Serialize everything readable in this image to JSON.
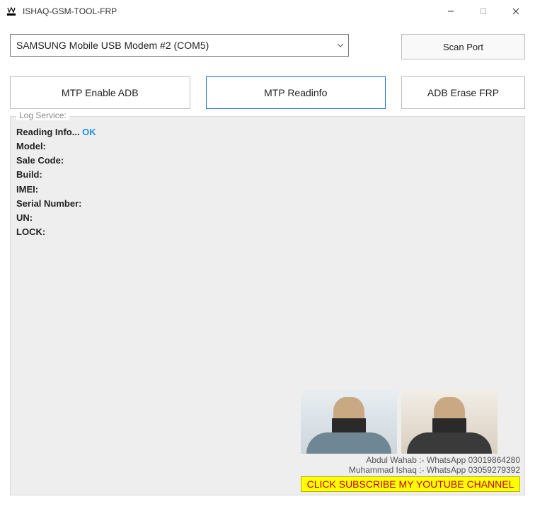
{
  "window": {
    "title": "ISHAQ-GSM-TOOL-FRP"
  },
  "port": {
    "selected": "SAMSUNG Mobile USB Modem #2 (COM5)"
  },
  "buttons": {
    "scan": "Scan Port",
    "mtp_adb": "MTP Enable ADB",
    "mtp_read": "MTP Readinfo",
    "adb_frp": "ADB Erase FRP"
  },
  "log": {
    "legend": "Log Service:",
    "reading_prefix": "Reading Info... ",
    "reading_status": "OK",
    "fields": {
      "model": "Model:",
      "sale": "Sale Code:",
      "build": "Build:",
      "imei": "IMEI:",
      "serial": "Serial Number:",
      "un": "UN:",
      "lock": "LOCK:"
    }
  },
  "footer": {
    "contact1": "Abdul Wahab :- WhatsApp 03019864280",
    "contact2": "Muhammad Ishaq :- WhatsApp 03059279392",
    "youtube": "CLICK SUBSCRIBE MY YOUTUBE CHANNEL"
  }
}
